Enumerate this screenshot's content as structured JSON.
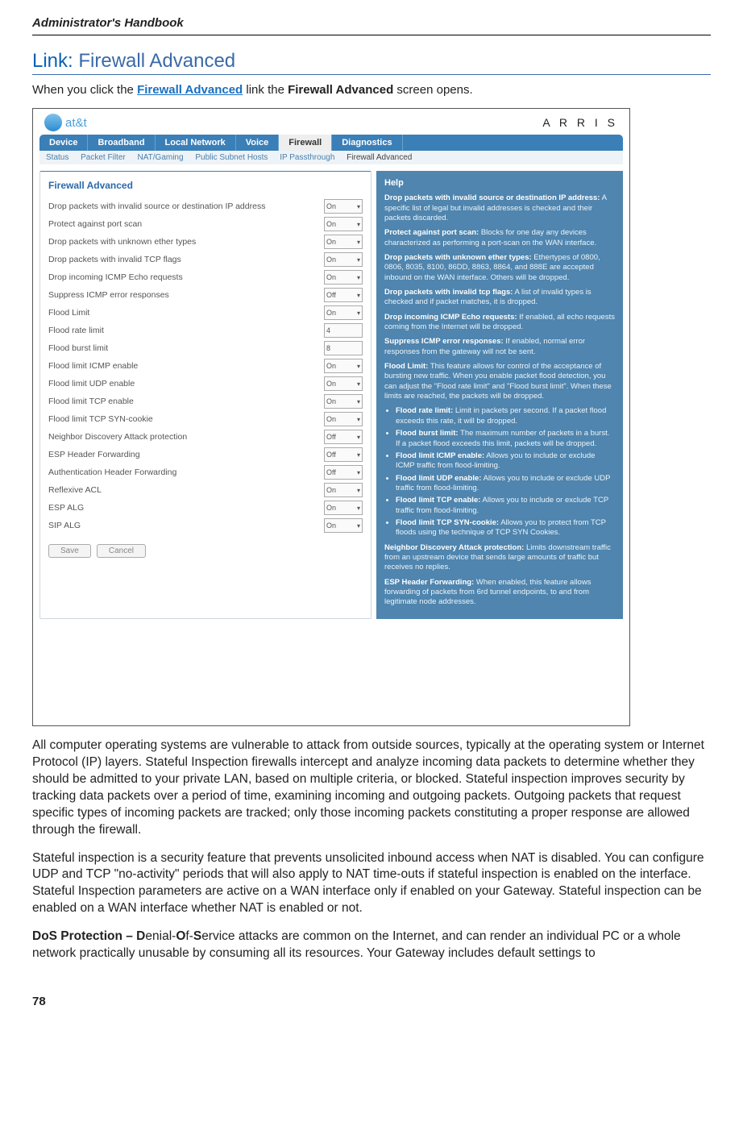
{
  "doc_header": "Administrator's Handbook",
  "section": {
    "link_label": "Link:",
    "title": "Firewall Advanced"
  },
  "intro": {
    "pre": "When you click the ",
    "link": "Firewall Advanced",
    "mid": " link the ",
    "bold": "Firewall Advanced",
    "post": " screen opens."
  },
  "screenshot": {
    "att": "at&t",
    "arris": "A R R I S",
    "tabs": [
      "Device",
      "Broadband",
      "Local Network",
      "Voice"
    ],
    "tab_active": "Firewall",
    "tab_after": "Diagnostics",
    "subtabs": [
      "Status",
      "Packet Filter",
      "NAT/Gaming",
      "Public Subnet Hosts",
      "IP Passthrough"
    ],
    "subtab_active": "Firewall Advanced",
    "panel_title": "Firewall Advanced",
    "options": [
      {
        "label": "Drop packets with invalid source or destination IP address",
        "type": "sel",
        "value": "On"
      },
      {
        "label": "Protect against port scan",
        "type": "sel",
        "value": "On"
      },
      {
        "label": "Drop packets with unknown ether types",
        "type": "sel",
        "value": "On"
      },
      {
        "label": "Drop packets with invalid TCP flags",
        "type": "sel",
        "value": "On"
      },
      {
        "label": "Drop incoming ICMP Echo requests",
        "type": "sel",
        "value": "On"
      },
      {
        "label": "Suppress ICMP error responses",
        "type": "sel",
        "value": "Off"
      },
      {
        "label": "Flood Limit",
        "type": "sel",
        "value": "On"
      },
      {
        "label": "Flood rate limit",
        "type": "inp",
        "value": "4"
      },
      {
        "label": "Flood burst limit",
        "type": "inp",
        "value": "8"
      },
      {
        "label": "Flood limit ICMP enable",
        "type": "sel",
        "value": "On"
      },
      {
        "label": "Flood limit UDP enable",
        "type": "sel",
        "value": "On"
      },
      {
        "label": "Flood limit TCP enable",
        "type": "sel",
        "value": "On"
      },
      {
        "label": "Flood limit TCP SYN-cookie",
        "type": "sel",
        "value": "On"
      },
      {
        "label": "Neighbor Discovery Attack protection",
        "type": "sel",
        "value": "Off"
      },
      {
        "label": "ESP Header Forwarding",
        "type": "sel",
        "value": "Off"
      },
      {
        "label": "Authentication Header Forwarding",
        "type": "sel",
        "value": "Off"
      },
      {
        "label": "Reflexive ACL",
        "type": "sel",
        "value": "On"
      },
      {
        "label": "ESP ALG",
        "type": "sel",
        "value": "On"
      },
      {
        "label": "SIP ALG",
        "type": "sel",
        "value": "On"
      }
    ],
    "save": "Save",
    "cancel": "Cancel",
    "help": {
      "title": "Help",
      "p1": {
        "b": "Drop packets with invalid source or destination IP address:",
        "t": " A specific list of legal but invalid addresses is checked and their packets discarded."
      },
      "p2": {
        "b": "Protect against port scan:",
        "t": " Blocks for one day any devices characterized as performing a port-scan on the WAN interface."
      },
      "p3": {
        "b": "Drop packets with unknown ether types:",
        "t": " Ethertypes of 0800, 0806, 8035, 8100, 86DD, 8863, 8864, and 888E are accepted inbound on the WAN interface. Others will be dropped."
      },
      "p4": {
        "b": "Drop packets with invalid tcp flags:",
        "t": " A list of invalid types is checked and if packet matches, it is dropped."
      },
      "p5": {
        "b": "Drop incoming ICMP Echo requests:",
        "t": " If enabled, all echo requests coming from the Internet will be dropped."
      },
      "p6": {
        "b": "Suppress ICMP error responses:",
        "t": " If enabled, normal error responses from the gateway will not be sent."
      },
      "p7": {
        "b": "Flood Limit:",
        "t": " This feature allows for control of the acceptance of bursting new traffic. When you enable packet flood detection, you can adjust the \"Flood rate limit\" and \"Flood burst limit\". When these limits are reached, the packets will be dropped."
      },
      "li1": {
        "b": "Flood rate limit:",
        "t": " Limit in packets per second. If a packet flood exceeds this rate, it will be dropped."
      },
      "li2": {
        "b": "Flood burst limit:",
        "t": " The maximum number of packets in a burst. If a packet flood exceeds this limit, packets will be dropped."
      },
      "li3": {
        "b": "Flood limit ICMP enable:",
        "t": " Allows you to include or exclude ICMP traffic from flood-limiting."
      },
      "li4": {
        "b": "Flood limit UDP enable:",
        "t": " Allows you to include or exclude UDP traffic from flood-limiting."
      },
      "li5": {
        "b": "Flood limit TCP enable:",
        "t": " Allows you to include or exclude TCP traffic from flood-limiting."
      },
      "li6": {
        "b": "Flood limit TCP SYN-cookie:",
        "t": " Allows you to protect from TCP floods using the technique of TCP SYN Cookies."
      },
      "p8": {
        "b": "Neighbor Discovery Attack protection:",
        "t": " Limits downstream traffic from an upstream device that sends large amounts of traffic but receives no replies."
      },
      "p9": {
        "b": "ESP Header Forwarding:",
        "t": " When enabled, this feature allows forwarding of packets from 6rd tunnel endpoints, to and from legitimate node addresses."
      }
    }
  },
  "para1": "All computer operating systems are vulnerable to attack from outside sources, typically at the operating system or Internet Protocol (IP) layers. Stateful Inspection firewalls intercept and analyze incoming data packets to determine whether they should be admitted to your private LAN, based on multiple criteria, or blocked. Stateful inspection improves security by tracking data packets over a period of time, examining incoming and outgoing packets. Outgoing packets that request specific types of incoming packets are tracked; only those incoming packets constituting a proper response are allowed through the firewall.",
  "para2": "Stateful inspection is a security feature that prevents unsolicited inbound access when NAT is disabled. You can configure UDP and TCP \"no-activity\" periods that will also apply to NAT time-outs if stateful inspection is enabled on the interface. Stateful Inspection parameters are active on a WAN interface only if enabled on your Gateway. Stateful inspection can be enabled on a WAN interface whether NAT is enabled or not.",
  "para3_bold": "DoS Protection – D",
  "para3_mid1": "enial-",
  "para3_b2": "O",
  "para3_mid2": "f-",
  "para3_b3": "S",
  "para3_rest": "ervice attacks are common on the Internet, and can render an individual PC or a whole network practically unusable by consuming all its resources. Your Gateway includes default settings to",
  "page_number": "78"
}
